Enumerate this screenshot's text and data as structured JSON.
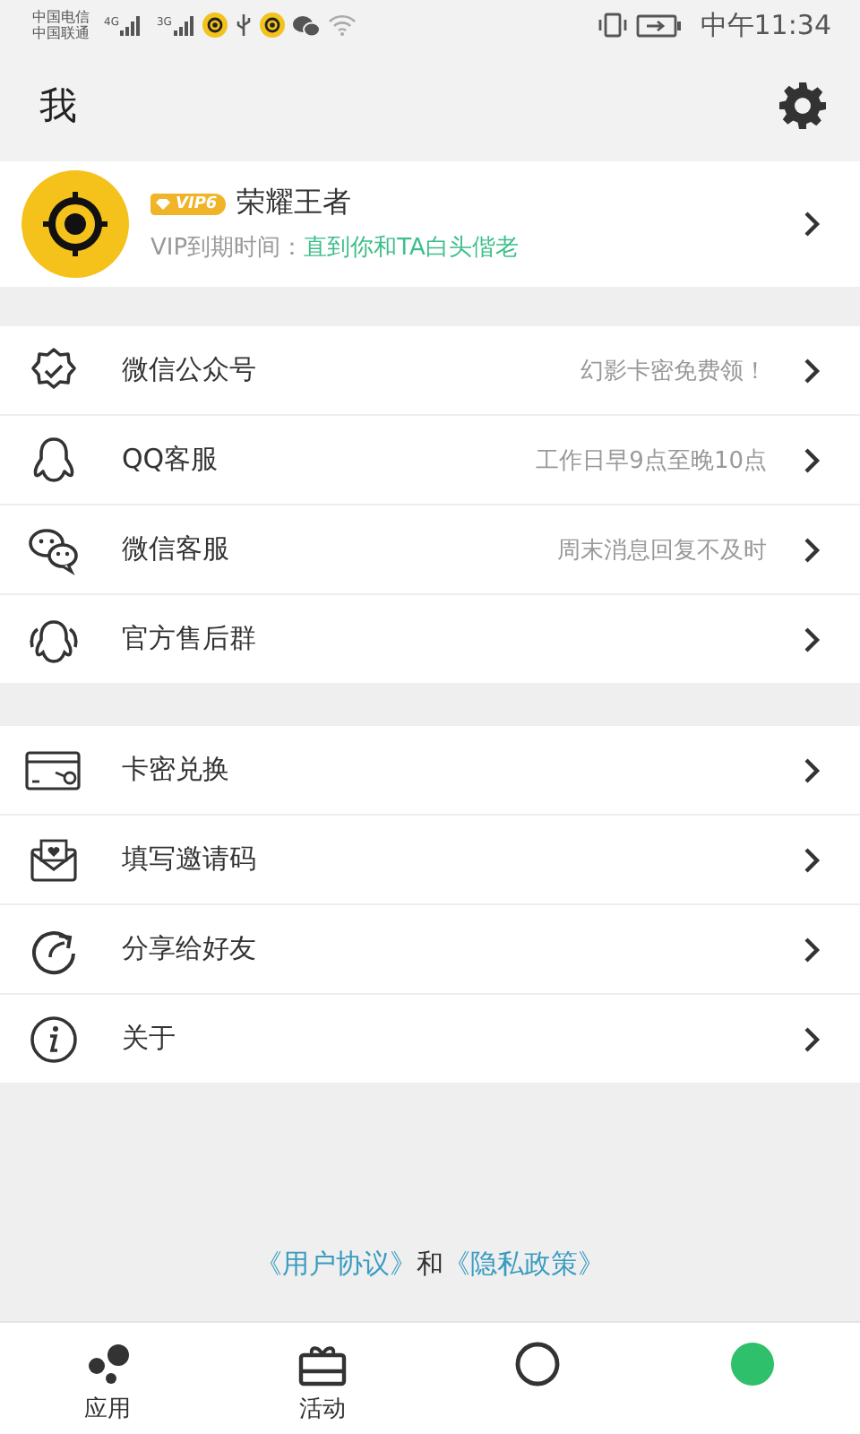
{
  "status_bar": {
    "carriers": [
      "中国电信",
      "中国联通"
    ],
    "networks": [
      "4G",
      "3G"
    ],
    "time": "中午11:34"
  },
  "header": {
    "title": "我"
  },
  "profile": {
    "vip_badge": "VIP6",
    "name": "荣耀王者",
    "expiry_label": "VIP到期时间：",
    "expiry_value": "直到你和TA白头偕老"
  },
  "menu_groups": [
    {
      "items": [
        {
          "kind": "verified",
          "label": "微信公众号",
          "hint": "幻影卡密免费领！"
        },
        {
          "kind": "qq",
          "label": "QQ客服",
          "hint": "工作日早9点至晚10点"
        },
        {
          "kind": "wechat",
          "label": "微信客服",
          "hint": "周末消息回复不及时"
        },
        {
          "kind": "group",
          "label": "官方售后群"
        }
      ]
    },
    {
      "items": [
        {
          "kind": "card",
          "label": "卡密兑换"
        },
        {
          "kind": "envelope",
          "label": "填写邀请码"
        },
        {
          "kind": "share",
          "label": "分享给好友"
        },
        {
          "kind": "info",
          "label": "关于"
        }
      ]
    }
  ],
  "footer": {
    "link_1": "《用户协议》",
    "joiner": "和",
    "link_2": "《隐私政策》"
  },
  "bottom_nav": [
    {
      "kind": "dots",
      "label": "应用"
    },
    {
      "kind": "gift",
      "label": "活动"
    },
    {
      "kind": "ring"
    },
    {
      "kind": "dot"
    }
  ]
}
